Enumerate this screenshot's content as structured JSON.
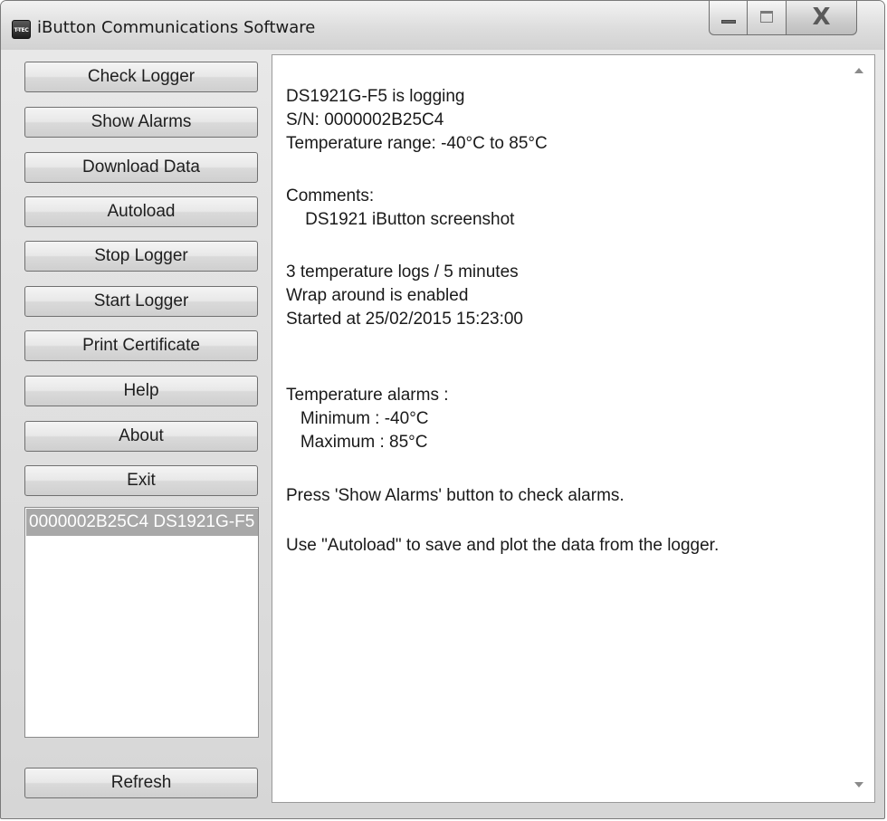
{
  "window": {
    "title": "iButton Communications Software",
    "icon_text": "T-TEC",
    "close_glyph": "X"
  },
  "sidebar": {
    "buttons": [
      {
        "label": "Check Logger"
      },
      {
        "label": "Show Alarms"
      },
      {
        "label": "Download Data"
      },
      {
        "label": "Autoload"
      },
      {
        "label": "Stop Logger"
      },
      {
        "label": "Start Logger"
      },
      {
        "label": "Print Certificate"
      },
      {
        "label": "Help"
      },
      {
        "label": "About"
      },
      {
        "label": "Exit"
      }
    ],
    "device_list": [
      {
        "text": "0000002B25C4 DS1921G-F5",
        "selected": true
      }
    ],
    "refresh_label": "Refresh"
  },
  "output": {
    "lines": [
      "DS1921G-F5 is logging",
      "S/N: 0000002B25C4",
      "Temperature range: -40°C to 85°C",
      "Comments:",
      "    DS1921 iButton screenshot",
      "3 temperature logs / 5 minutes",
      "Wrap around is enabled",
      "Started at 25/02/2015 15:23:00",
      "Temperature alarms :",
      "   Minimum : -40°C",
      "   Maximum : 85°C",
      "Press 'Show Alarms' button to check alarms.",
      "Use \"Autoload\" to save and plot the data from the logger."
    ]
  },
  "colors": {
    "selection": "#a8a8a8",
    "window_background": "#dcdcdc"
  }
}
